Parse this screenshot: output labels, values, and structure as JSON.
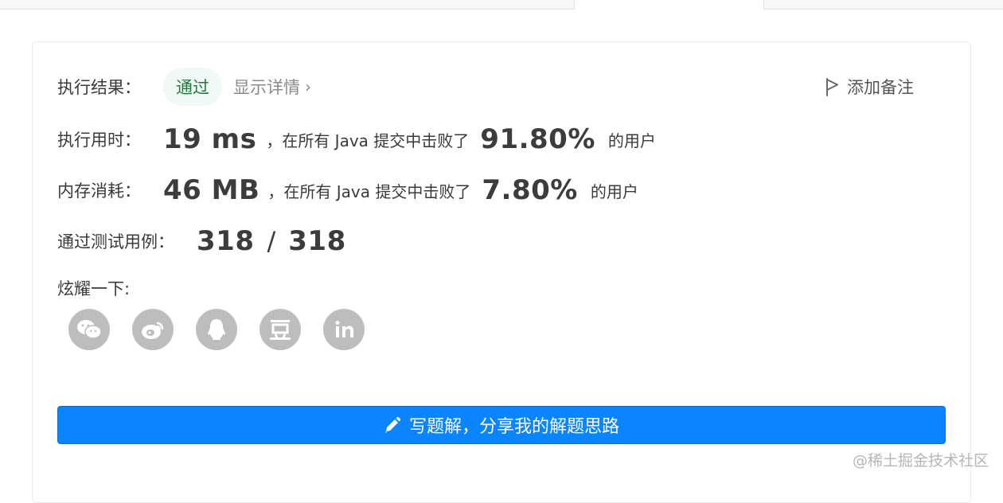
{
  "result": {
    "label": "执行结果：",
    "status": "通过",
    "detail_link": "显示详情",
    "add_note": "添加备注"
  },
  "runtime": {
    "label": "执行用时：",
    "value": "19 ms",
    "text_before": "，在所有 Java 提交中击败了",
    "percent": "91.80%",
    "text_after": "的用户"
  },
  "memory": {
    "label": "内存消耗：",
    "value": "46 MB",
    "text_before": "，在所有 Java 提交中击败了",
    "percent": "7.80%",
    "text_after": "的用户"
  },
  "testcases": {
    "label": "通过测试用例：",
    "passed": "318",
    "separator": "/",
    "total": "318"
  },
  "share": {
    "label": "炫耀一下:",
    "icons": [
      "wechat-icon",
      "weibo-icon",
      "qq-icon",
      "douban-icon",
      "linkedin-icon"
    ]
  },
  "write_solution": {
    "label": "写题解，分享我的解题思路"
  },
  "watermark": "@稀土掘金技术社区",
  "colors": {
    "primary": "#0a84ff",
    "pass_text": "#1e7a3a",
    "pass_bg": "#f0f9f3",
    "icon_gray": "#bdbdbd"
  }
}
